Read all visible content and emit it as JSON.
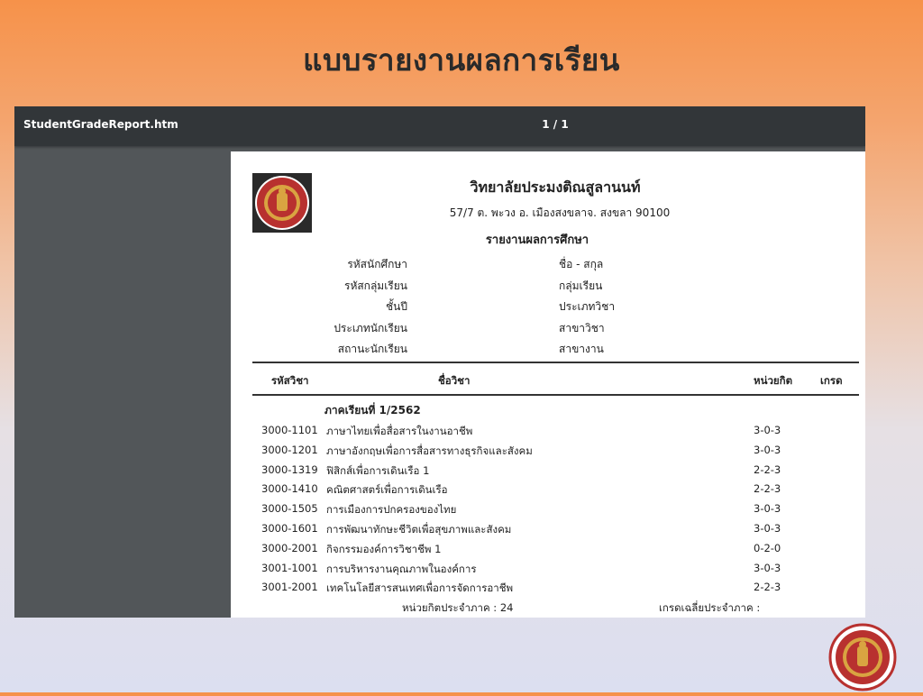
{
  "slide": {
    "title": "แบบรายงานผลการเรียน"
  },
  "viewer": {
    "filename": "StudentGradeReport.htm",
    "page_indicator": "1 / 1"
  },
  "report": {
    "college_name": "วิทยาลัยประมงติณสูลานนท์",
    "address": "57/7  ต. พะวง อ. เมืองสงขลาจ. สงขลา 90100",
    "heading": "รายงานผลการศึกษา",
    "info_labels_left": [
      "รหัสนักศึกษา",
      "รหัสกลุ่มเรียน",
      "ชั้นปี",
      "ประเภทนักเรียน",
      "สถานะนักเรียน"
    ],
    "info_labels_right": [
      "ชื่อ - สกุล",
      "กลุ่มเรียน",
      "ประเภทวิชา",
      "สาขาวิชา",
      "สาขางาน"
    ],
    "table_headers": {
      "code": "รหัสวิชา",
      "name": "ชื่อวิชา",
      "credits": "หน่วยกิต",
      "grade": "เกรด"
    },
    "semester_label": "ภาคเรียนที่  1/2562",
    "courses": [
      {
        "code": "3000-1101",
        "name": "ภาษาไทยเพื่อสื่อสารในงานอาชีพ",
        "credits": "3-0-3",
        "grade": ""
      },
      {
        "code": "3000-1201",
        "name": "ภาษาอังกฤษเพื่อการสื่อสารทางธุรกิจและสังคม",
        "credits": "3-0-3",
        "grade": ""
      },
      {
        "code": "3000-1319",
        "name": "ฟิสิกส์เพื่อการเดินเรือ 1",
        "credits": "2-2-3",
        "grade": ""
      },
      {
        "code": "3000-1410",
        "name": "คณิตศาสตร์เพื่อการเดินเรือ",
        "credits": "2-2-3",
        "grade": ""
      },
      {
        "code": "3000-1505",
        "name": "การเมืองการปกครองของไทย",
        "credits": "3-0-3",
        "grade": ""
      },
      {
        "code": "3000-1601",
        "name": "การพัฒนาทักษะชีวิตเพื่อสุขภาพและสังคม",
        "credits": "3-0-3",
        "grade": ""
      },
      {
        "code": "3000-2001",
        "name": "กิจกรรมองค์การวิชาชีพ 1",
        "credits": "0-2-0",
        "grade": ""
      },
      {
        "code": "3001-1001",
        "name": "การบริหารงานคุณภาพในองค์การ",
        "credits": "3-0-3",
        "grade": ""
      },
      {
        "code": "3001-2001",
        "name": "เทคโนโลยีสารสนเทศเพื่อการจัดการอาชีพ",
        "credits": "2-2-3",
        "grade": ""
      }
    ],
    "footer_credits": "หน่วยกิตประจำภาค : 24",
    "footer_gpa": "เกรดเฉลี่ยประจำภาค :"
  },
  "colors": {
    "toolbar": "#323639",
    "viewer_bg": "#525659",
    "logo_red": "#b8312f",
    "logo_gold": "#d9a441"
  },
  "icons": {
    "report_logo": "college-emblem-icon",
    "corner_logo": "college-seal-icon"
  }
}
